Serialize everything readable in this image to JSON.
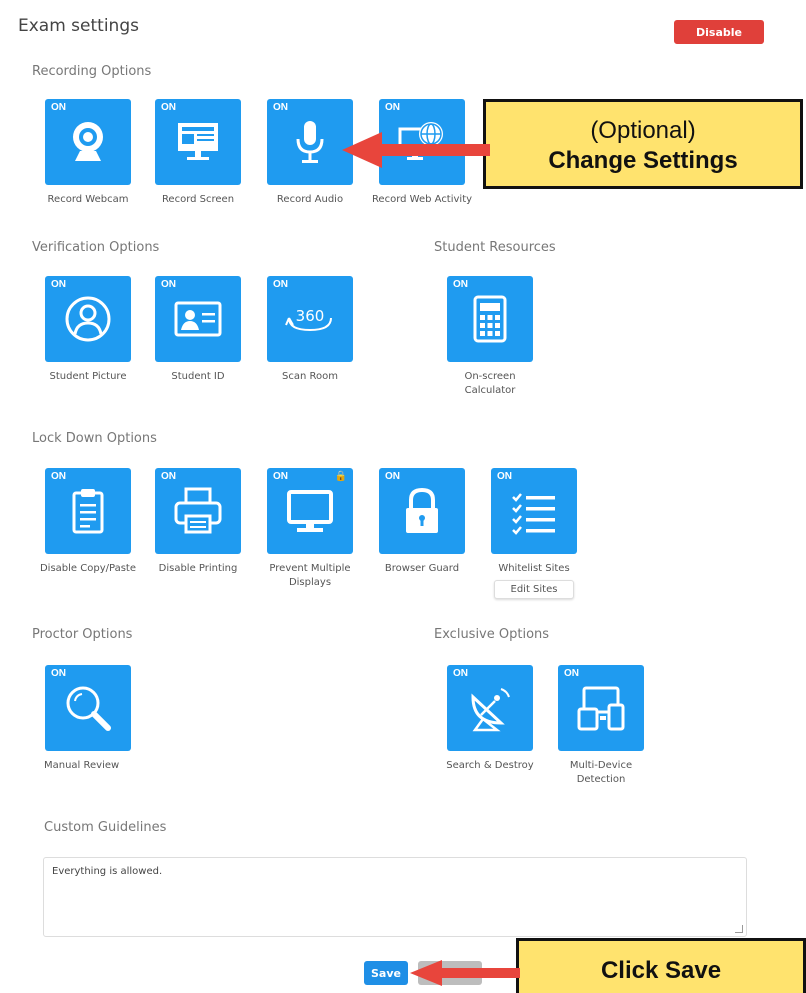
{
  "header": {
    "title": "Exam settings",
    "disable_label": "Disable"
  },
  "sections": {
    "recording": "Recording Options",
    "verification": "Verification Options",
    "resources": "Student Resources",
    "lockdown": "Lock Down Options",
    "proctor": "Proctor Options",
    "exclusive": "Exclusive Options"
  },
  "tiles": {
    "record_webcam": {
      "status": "ON",
      "label": "Record Webcam",
      "icon": "webcam-icon"
    },
    "record_screen": {
      "status": "ON",
      "label": "Record Screen",
      "icon": "screen-icon"
    },
    "record_audio": {
      "status": "ON",
      "label": "Record Audio",
      "icon": "microphone-icon"
    },
    "record_web": {
      "status": "ON",
      "label": "Record Web Activity",
      "icon": "globe-monitor-icon"
    },
    "student_picture": {
      "status": "ON",
      "label": "Student Picture",
      "icon": "user-icon"
    },
    "student_id": {
      "status": "ON",
      "label": "Student ID",
      "icon": "id-card-icon"
    },
    "scan_room": {
      "status": "ON",
      "label": "Scan Room",
      "icon": "360-icon",
      "glyph": "360"
    },
    "calculator": {
      "status": "ON",
      "label": "On-screen Calculator",
      "icon": "calculator-icon"
    },
    "copy_paste": {
      "status": "ON",
      "label": "Disable Copy/Paste",
      "icon": "clipboard-icon"
    },
    "printing": {
      "status": "ON",
      "label": "Disable Printing",
      "icon": "printer-icon"
    },
    "multi_display": {
      "status": "ON",
      "label": "Prevent Multiple Displays",
      "icon": "monitor-icon"
    },
    "browser_guard": {
      "status": "ON",
      "label": "Browser Guard",
      "icon": "padlock-icon"
    },
    "whitelist": {
      "status": "ON",
      "label": "Whitelist Sites",
      "icon": "checklist-icon",
      "edit_label": "Edit Sites"
    },
    "manual_review": {
      "status": "ON",
      "label": "Manual Review",
      "icon": "magnifier-icon"
    },
    "search_destroy": {
      "status": "ON",
      "label": "Search & Destroy",
      "icon": "satellite-dish-icon"
    },
    "multi_device": {
      "status": "ON",
      "label": "Multi-Device Detection",
      "icon": "devices-icon"
    }
  },
  "guidelines": {
    "label": "Custom Guidelines",
    "value": "Everything is allowed."
  },
  "footer": {
    "save_label": "Save"
  },
  "callouts": {
    "settings_line1": "(Optional)",
    "settings_line2": "Change Settings",
    "save": "Click Save"
  },
  "colors": {
    "tile": "#1f9bf0",
    "disable": "#e0403a",
    "callout": "#ffe36e",
    "arrow": "#e8453c"
  }
}
